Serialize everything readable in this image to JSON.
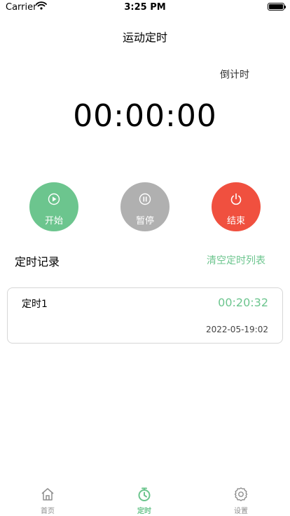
{
  "status_bar": {
    "carrier": "Carrier",
    "time": "3:25 PM"
  },
  "nav": {
    "title": "运动定时"
  },
  "mode_label": "倒计时",
  "timer": {
    "display": "00:00:00"
  },
  "controls": {
    "start": "开始",
    "pause": "暂停",
    "stop": "结束"
  },
  "records": {
    "title": "定时记录",
    "clear_label": "清空定时列表",
    "items": [
      {
        "name": "定时1",
        "duration": "00:20:32",
        "date": "2022-05-19:02"
      }
    ]
  },
  "tab_bar": {
    "items": [
      {
        "label": "首页",
        "icon": "home-icon"
      },
      {
        "label": "定时",
        "icon": "stopwatch-icon"
      },
      {
        "label": "设置",
        "icon": "gear-icon"
      }
    ],
    "active_color": "#6cc58e",
    "inactive_color": "#8e8e8e"
  },
  "colors": {
    "accent": "#6cc58e",
    "pause": "#b0b0b0",
    "stop": "#f0503f"
  }
}
